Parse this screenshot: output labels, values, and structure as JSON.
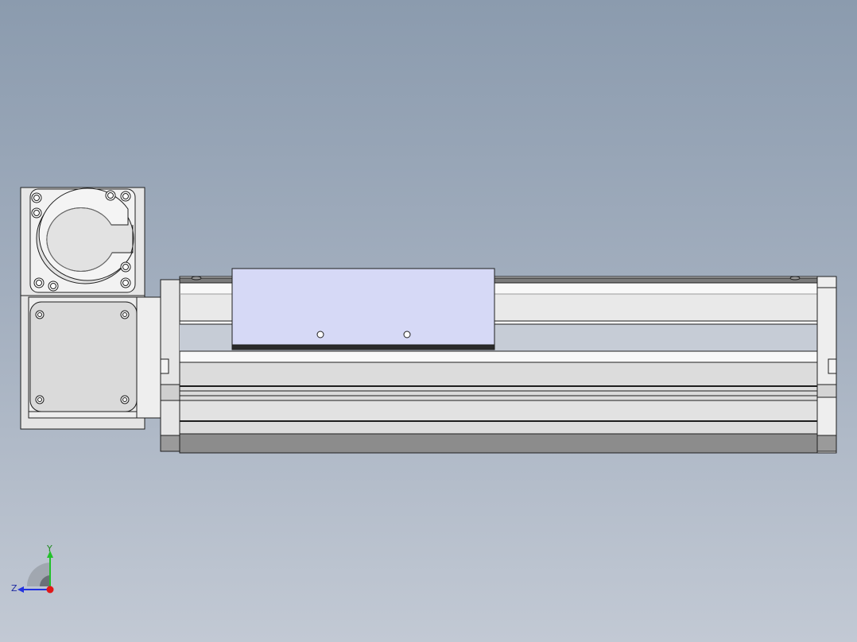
{
  "colors": {
    "bg_top": "#8b9bae",
    "bg_bottom": "#c2c9d4",
    "outline": "#1e1e1e",
    "metal_light": "#f2f2f2",
    "metal_mid": "#d8d8d8",
    "metal_dark": "#8a8a8a",
    "carriage": "#d6d9f6",
    "axis_y": "#22c02a",
    "axis_z": "#2332e0",
    "axis_origin": "#e01818"
  },
  "model": {
    "motor": "motor-gearbox",
    "actuator": "linear-actuator",
    "carriage": "slide-carriage"
  },
  "triad": {
    "y_label": "Y",
    "z_label": "Z",
    "icon": "coordinate-triad-icon"
  }
}
